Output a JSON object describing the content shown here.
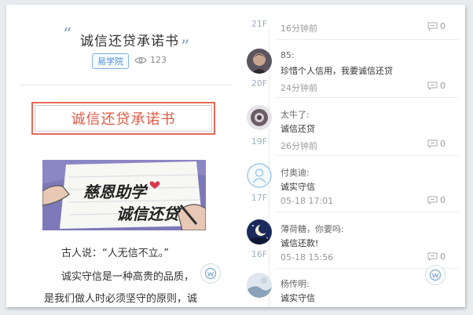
{
  "article": {
    "title": "诚信还贷承诺书",
    "category": "易学院",
    "views": "123",
    "headline": "诚信还贷承诺书",
    "banner_line1": "慈恩助学",
    "banner_line2": "诚信还贷",
    "paragraph1": "古人说：“人无信不立。”",
    "paragraph2": "诚实守信是一种高贵的品质，",
    "paragraph3": "是我们做人时必须坚守的原则，诚"
  },
  "comments": [
    {
      "floor": "21F",
      "name": "",
      "text": "",
      "time": "16分钟前",
      "replies": "0"
    },
    {
      "floor": "20F",
      "name": "85:",
      "text": "珍惜个人信用，我要诚信还贷",
      "time": "24分钟前",
      "replies": "0"
    },
    {
      "floor": "19F",
      "name": "太牛了:",
      "text": "诚信还贷",
      "time": "26分钟前",
      "replies": "0"
    },
    {
      "floor": "17F",
      "name": "付奥迪:",
      "text": "诚实守信",
      "time": "05-18 17:01",
      "replies": "0"
    },
    {
      "floor": "16F",
      "name": "薄荷糖，你要吗:",
      "text": "诚信还款!",
      "time": "05-18 15:56",
      "replies": "0"
    },
    {
      "floor": "",
      "name": "杨传明:",
      "text": "诚实守信",
      "time": "",
      "replies": ""
    }
  ],
  "icons": {
    "views": "eye-icon",
    "reply": "comment-icon",
    "share": "wechat-icon"
  },
  "colors": {
    "accent": "#e05a45",
    "tag": "#4d8fd6",
    "floor": "#9ab0c7"
  }
}
